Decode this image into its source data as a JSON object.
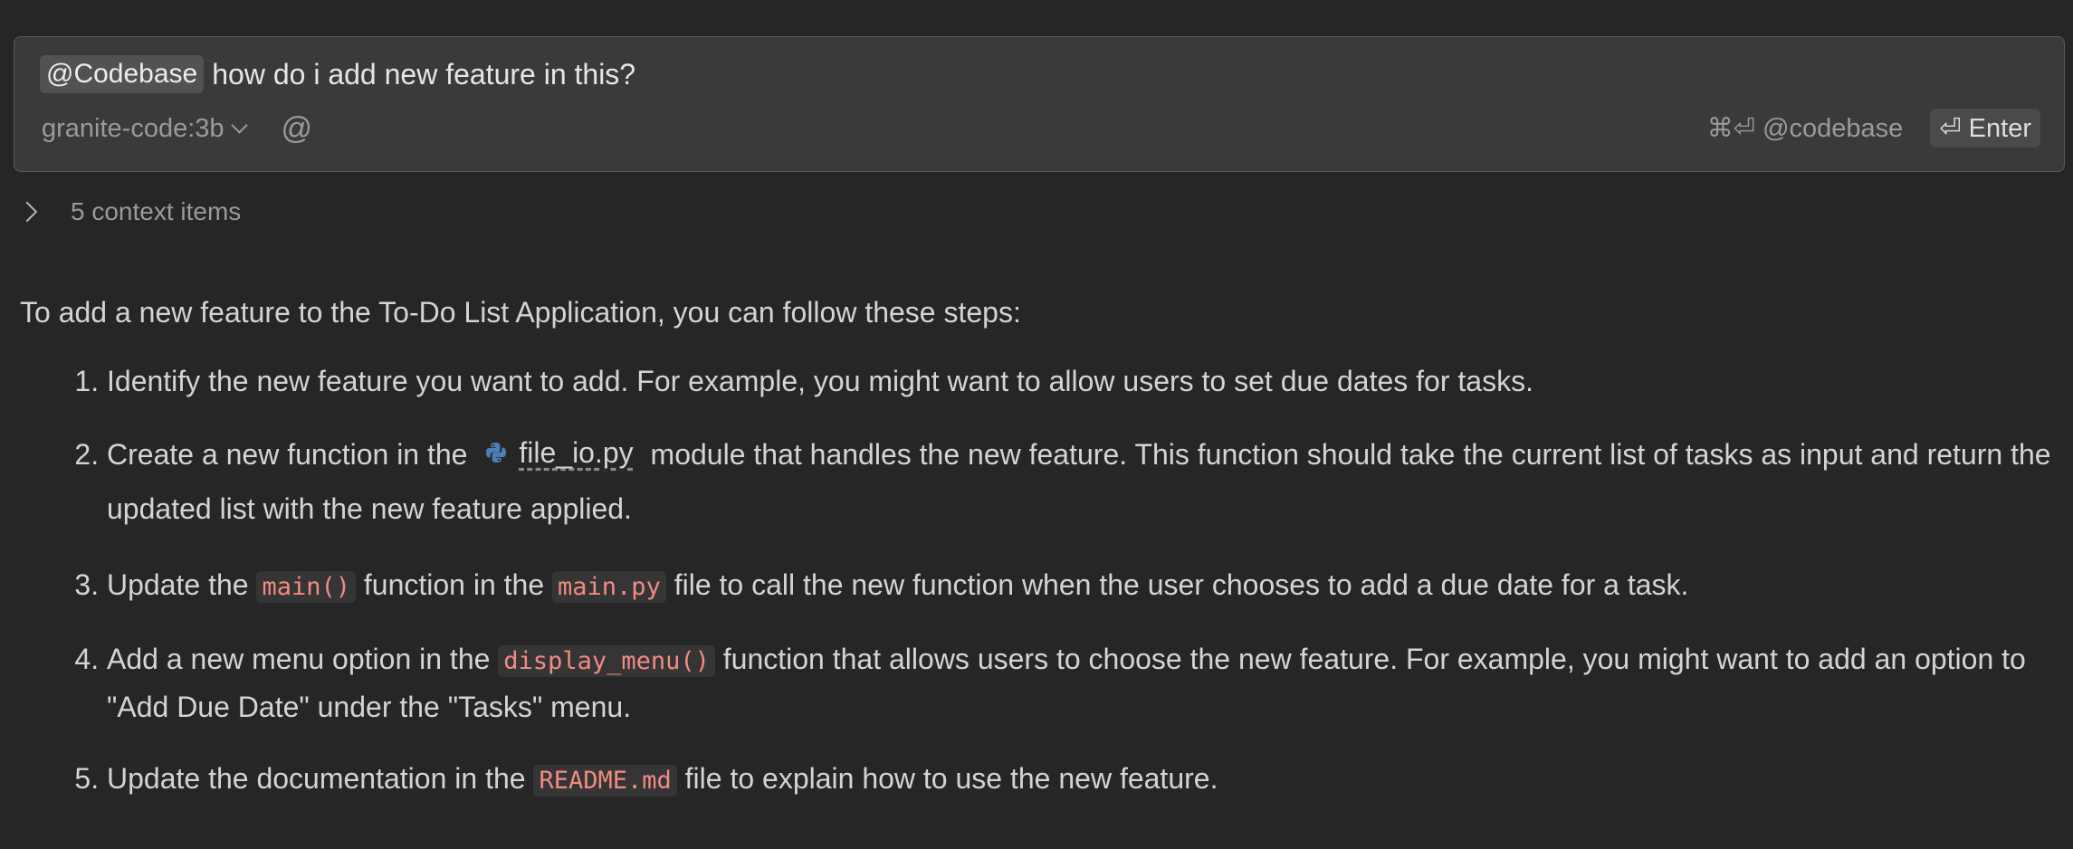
{
  "input": {
    "mention": "@Codebase",
    "query": "how do i add new feature in this?",
    "model": "granite-code:3b",
    "at_symbol": "@",
    "shortcut_hint": "⌘⏎ @codebase",
    "enter_label": "⏎ Enter"
  },
  "context": {
    "label": "5 context items"
  },
  "answer": {
    "intro": "To add a new feature to the To-Do List Application, you can follow these steps:",
    "step1": {
      "text": "Identify the new feature you want to add. For example, you might want to allow users to set due dates for tasks."
    },
    "step2": {
      "pre": "Create a new function in the",
      "file": "file_io.py",
      "post": "module that handles the new feature. This function should take the current list of tasks as input and return the updated list with the new feature applied."
    },
    "step3": {
      "pre": "Update the",
      "code1": "main()",
      "mid": "function in the",
      "code2": "main.py",
      "post": "file to call the new function when the user chooses to add a due date for a task."
    },
    "step4": {
      "pre": "Add a new menu option in the",
      "code": "display_menu()",
      "post": "function that allows users to choose the new feature. For example, you might want to add an option to \"Add Due Date\" under the \"Tasks\" menu."
    },
    "step5": {
      "pre": "Update the documentation in the",
      "code": "README.md",
      "post": "file to explain how to use the new feature."
    }
  },
  "colors": {
    "background": "#262626",
    "input_background": "#3a3a3a",
    "code_text": "#f28b82",
    "python_icon_blue": "#4a7fb5",
    "python_icon_yellow": "#ffd43b"
  },
  "icons": [
    "chevron-down-icon",
    "at-icon",
    "chevron-right-icon",
    "python-file-icon"
  ]
}
